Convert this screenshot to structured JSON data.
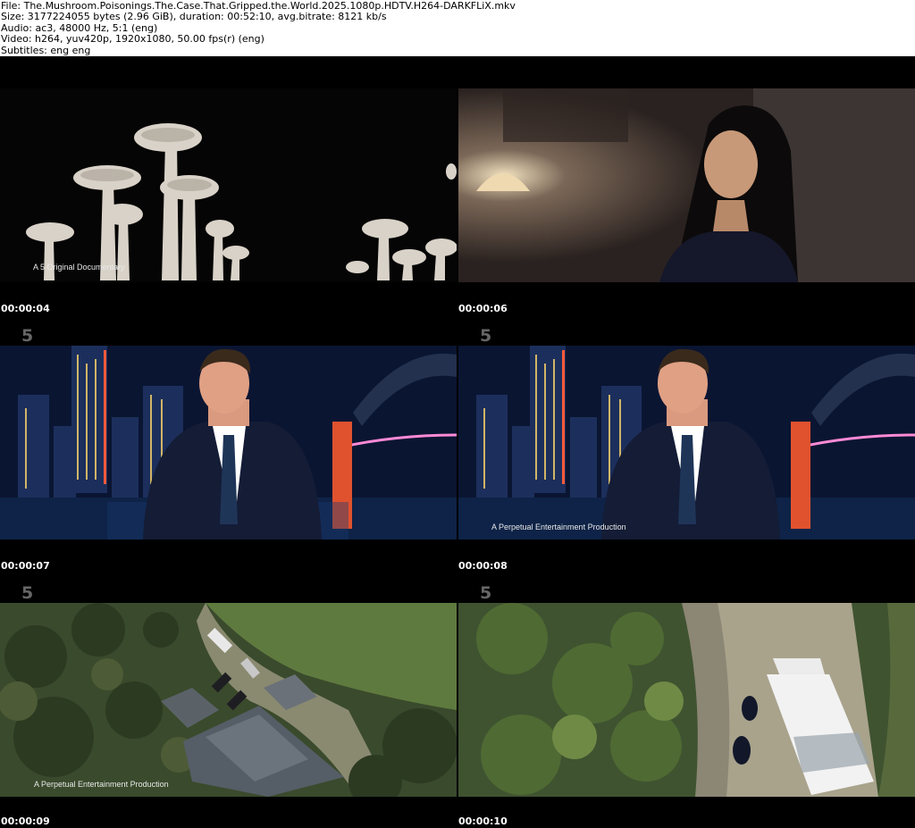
{
  "header": {
    "file": "File: The.Mushroom.Poisonings.The.Case.That.Gripped.the.World.2025.1080p.HDTV.H264-DARKFLiX.mkv",
    "size": "Size: 3177224055 bytes (2.96 GiB), duration: 00:52:10, avg.bitrate: 8121 kb/s",
    "audio": "Audio: ac3, 48000 Hz, 5:1 (eng)",
    "video": "Video: h264, yuv420p, 1920x1080, 50.00 fps(r) (eng)",
    "subtitles": "Subtitles: eng eng"
  },
  "channel_logo": "5",
  "frames": [
    {
      "scene": "mushrooms",
      "caption": "A 5 Original Documentary",
      "timestamp": "00:00:04",
      "logo": false
    },
    {
      "scene": "interview-woman",
      "caption": "",
      "timestamp": "00:00:06",
      "logo": false
    },
    {
      "scene": "news-anchor",
      "caption": "",
      "timestamp": "00:00:07",
      "logo": true
    },
    {
      "scene": "news-anchor",
      "caption": "A Perpetual Entertainment Production",
      "timestamp": "00:00:08",
      "logo": true
    },
    {
      "scene": "aerial-house",
      "caption": "A Perpetual Entertainment Production",
      "timestamp": "00:00:09",
      "logo": true
    },
    {
      "scene": "aerial-police",
      "caption": "",
      "timestamp": "00:00:10",
      "logo": true
    }
  ]
}
